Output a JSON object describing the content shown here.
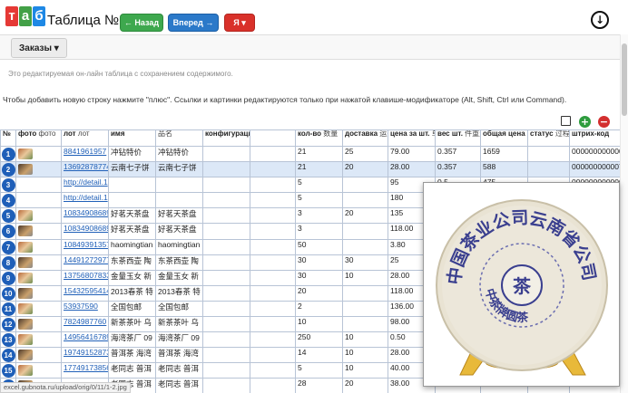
{
  "app": {
    "logo_letters": [
      "т",
      "а",
      "б"
    ],
    "title": "Таблица №11"
  },
  "toolbar": {
    "back_label": "← Назад",
    "forward_label": "Вперед →",
    "user_label": "Я ▾",
    "download_icon": "download-icon"
  },
  "tabs": [
    {
      "label": "Заказы ▾"
    }
  ],
  "notes": {
    "editable": "Это редактируемая он-лайн таблица с сохранением содержимого.",
    "instructions": "Чтобы добавить новую строку нажмите \"плюс\". Ссылки и картинки редактируются только при нажатой клавише-модификаторе (Alt, Shift, Ctrl или Command)."
  },
  "table": {
    "columns": [
      {
        "label": "№",
        "sub": ""
      },
      {
        "label": "фото",
        "sub": "фото"
      },
      {
        "label": "лот",
        "sub": "лот"
      },
      {
        "label": "имя",
        "sub": ""
      },
      {
        "label": "",
        "sub": "品名"
      },
      {
        "label": "конфигурация",
        "sub": "規格"
      },
      {
        "label": "",
        "sub": ""
      },
      {
        "label": "кол-во",
        "sub": "数量"
      },
      {
        "label": "доставка",
        "sub": "运费"
      },
      {
        "label": "цена за шт.",
        "sub": "单价"
      },
      {
        "label": "вес шт.",
        "sub": "件重量"
      },
      {
        "label": "общая цена",
        "sub": "总价"
      },
      {
        "label": "статус",
        "sub": "过程"
      },
      {
        "label": "штрих-код",
        "sub": ""
      }
    ],
    "rows": [
      {
        "n": "1",
        "thumb": true,
        "lot": "8841961957",
        "name": "冲钻特价",
        "name_cn": "冲钻特价",
        "qty": "21",
        "delivery": "25",
        "price": "79.00",
        "weight": "0.357",
        "total": "1659",
        "status": "",
        "barcode": "000000000000"
      },
      {
        "n": "2",
        "thumb": true,
        "lot": "13692878774",
        "name": "云南七子饼",
        "name_cn": "云南七子饼",
        "qty": "21",
        "delivery": "20",
        "price": "28.00",
        "weight": "0.357",
        "total": "588",
        "status": "",
        "barcode": "000000000007"
      },
      {
        "n": "3",
        "thumb": false,
        "lot": "http://detail.1",
        "name": "",
        "name_cn": "",
        "qty": "5",
        "delivery": "",
        "price": "95",
        "weight": "0.5",
        "total": "475",
        "status": "",
        "barcode": "000000000000"
      },
      {
        "n": "4",
        "thumb": false,
        "lot": "http://detail.1",
        "name": "",
        "name_cn": "",
        "qty": "5",
        "delivery": "",
        "price": "180",
        "weight": "",
        "total": "",
        "status": "",
        "barcode": ""
      },
      {
        "n": "5",
        "thumb": true,
        "lot": "10834908689",
        "name": "好茗天茶盘",
        "name_cn": "好茗天茶盘",
        "qty": "3",
        "delivery": "20",
        "price": "135",
        "weight": "",
        "total": "",
        "status": "",
        "barcode": ""
      },
      {
        "n": "6",
        "thumb": true,
        "lot": "10834908689",
        "name": "好茗天茶盘",
        "name_cn": "好茗天茶盘",
        "qty": "3",
        "delivery": "",
        "price": "118.00",
        "weight": "",
        "total": "",
        "status": "",
        "barcode": ""
      },
      {
        "n": "7",
        "thumb": true,
        "lot": "10849391357",
        "name": "haomingtian",
        "name_cn": "haomingtian",
        "qty": "50",
        "delivery": "",
        "price": "3.80",
        "weight": "",
        "total": "",
        "status": "",
        "barcode": ""
      },
      {
        "n": "8",
        "thumb": true,
        "lot": "14491272977",
        "name": "东茶西壶 陶",
        "name_cn": "东茶西壶 陶",
        "qty": "30",
        "delivery": "30",
        "price": "25",
        "weight": "",
        "total": "",
        "status": "",
        "barcode": ""
      },
      {
        "n": "9",
        "thumb": true,
        "lot": "13756807833",
        "name": "金量玉女 新",
        "name_cn": "金量玉女 新",
        "qty": "30",
        "delivery": "10",
        "price": "28.00",
        "weight": "",
        "total": "",
        "status": "",
        "barcode": ""
      },
      {
        "n": "10",
        "thumb": true,
        "lot": "15432595414",
        "name": "2013春茶 特",
        "name_cn": "2013春茶 特",
        "qty": "20",
        "delivery": "",
        "price": "118.00",
        "weight": "",
        "total": "",
        "status": "",
        "barcode": ""
      },
      {
        "n": "11",
        "thumb": true,
        "lot": "53937590",
        "name": "全国包邮",
        "name_cn": "全国包邮",
        "qty": "2",
        "delivery": "",
        "price": "136.00",
        "weight": "",
        "total": "",
        "status": "",
        "barcode": ""
      },
      {
        "n": "12",
        "thumb": true,
        "lot": "7824987760",
        "name": "新茶茶叶 乌",
        "name_cn": "新茶茶叶 乌",
        "qty": "10",
        "delivery": "",
        "price": "98.00",
        "weight": "",
        "total": "",
        "status": "",
        "barcode": ""
      },
      {
        "n": "13",
        "thumb": true,
        "lot": "14956416789",
        "name": "海湾茶厂 09",
        "name_cn": "海湾茶厂 09",
        "qty": "250",
        "delivery": "10",
        "price": "0.50",
        "weight": "",
        "total": "",
        "status": "",
        "barcode": ""
      },
      {
        "n": "14",
        "thumb": true,
        "lot": "19749152873",
        "name": "普洱茶 海湾",
        "name_cn": "普洱茶 海湾",
        "qty": "14",
        "delivery": "10",
        "price": "28.00",
        "weight": "",
        "total": "",
        "status": "",
        "barcode": ""
      },
      {
        "n": "15",
        "thumb": true,
        "lot": "17749173856",
        "name": "老同志 普洱",
        "name_cn": "老同志 普洱",
        "qty": "5",
        "delivery": "10",
        "price": "40.00",
        "weight": "",
        "total": "",
        "status": "",
        "barcode": ""
      },
      {
        "n": "16",
        "thumb": true,
        "lot": "",
        "name": "老同志 普洱",
        "name_cn": "老同志 普洱",
        "qty": "28",
        "delivery": "20",
        "price": "38.00",
        "weight": "",
        "total": "",
        "status": "",
        "barcode": ""
      }
    ]
  },
  "preview": {
    "ring_text": "中国茶业公司云南省公司",
    "inner_text": "中茶牌圆茶",
    "center_char": "茶"
  },
  "status_url": "excel.gubnota.ru/upload/orig/0/11/1-2.jpg",
  "colors": {
    "back_button": "#3ea84e",
    "forward_button": "#2b79c9",
    "user_button": "#d9312a",
    "row_badge": "#1f5fb8",
    "highlight_row": "#dce8f7",
    "link": "#2060b8"
  }
}
